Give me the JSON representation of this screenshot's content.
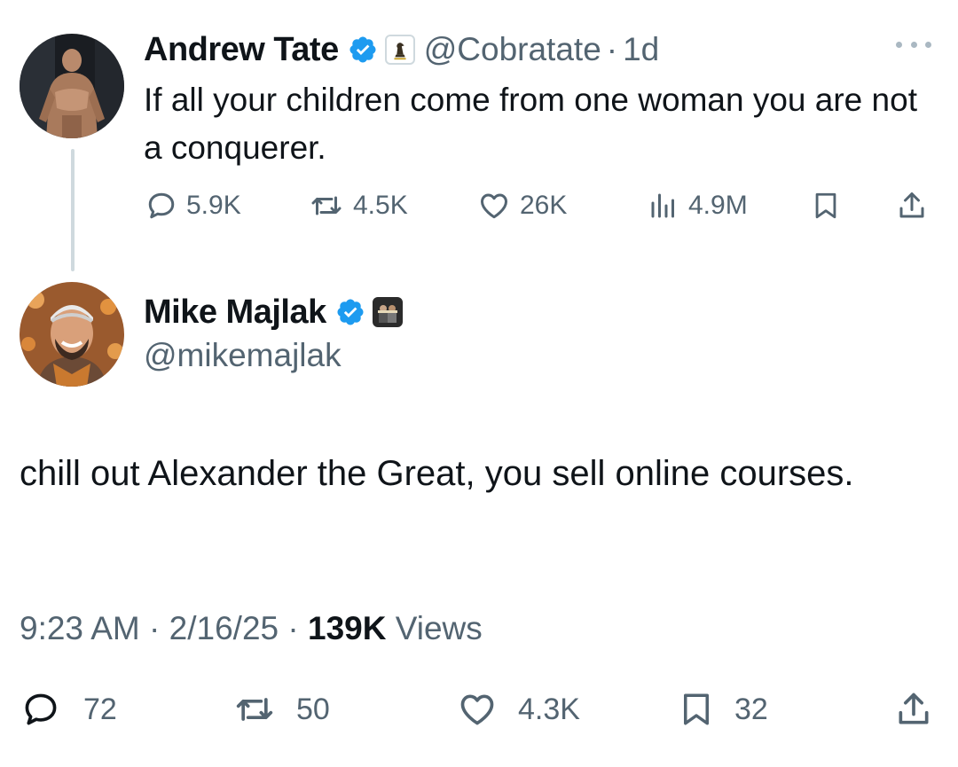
{
  "tweet1": {
    "author_name": "Andrew Tate",
    "handle": "@Cobratate",
    "separator": "·",
    "time": "1d",
    "text": "If all your children come from one woman you are not a conquerer.",
    "replies": "5.9K",
    "reposts": "4.5K",
    "likes": "26K",
    "views": "4.9M"
  },
  "tweet2": {
    "author_name": "Mike Majlak",
    "handle": "@mikemajlak",
    "text": "chill out Alexander the Great, you sell online courses.",
    "time": "9:23 AM",
    "date": "2/16/25",
    "separator": "·",
    "views_count": "139K",
    "views_label": "Views",
    "replies": "72",
    "reposts": "50",
    "likes": "4.3K",
    "bookmarks": "32"
  },
  "colors": {
    "text": "#0f1419",
    "secondary": "#536471",
    "verified": "#1d9bf0",
    "thread_line": "#cfd9de"
  },
  "icons": {
    "reply": "speech-bubble-icon",
    "repost": "repost-arrows-icon",
    "like": "heart-icon",
    "views": "bar-chart-icon",
    "bookmark": "bookmark-icon",
    "share": "share-upload-icon",
    "more": "more-dots-icon",
    "verified": "verified-badge-icon"
  }
}
